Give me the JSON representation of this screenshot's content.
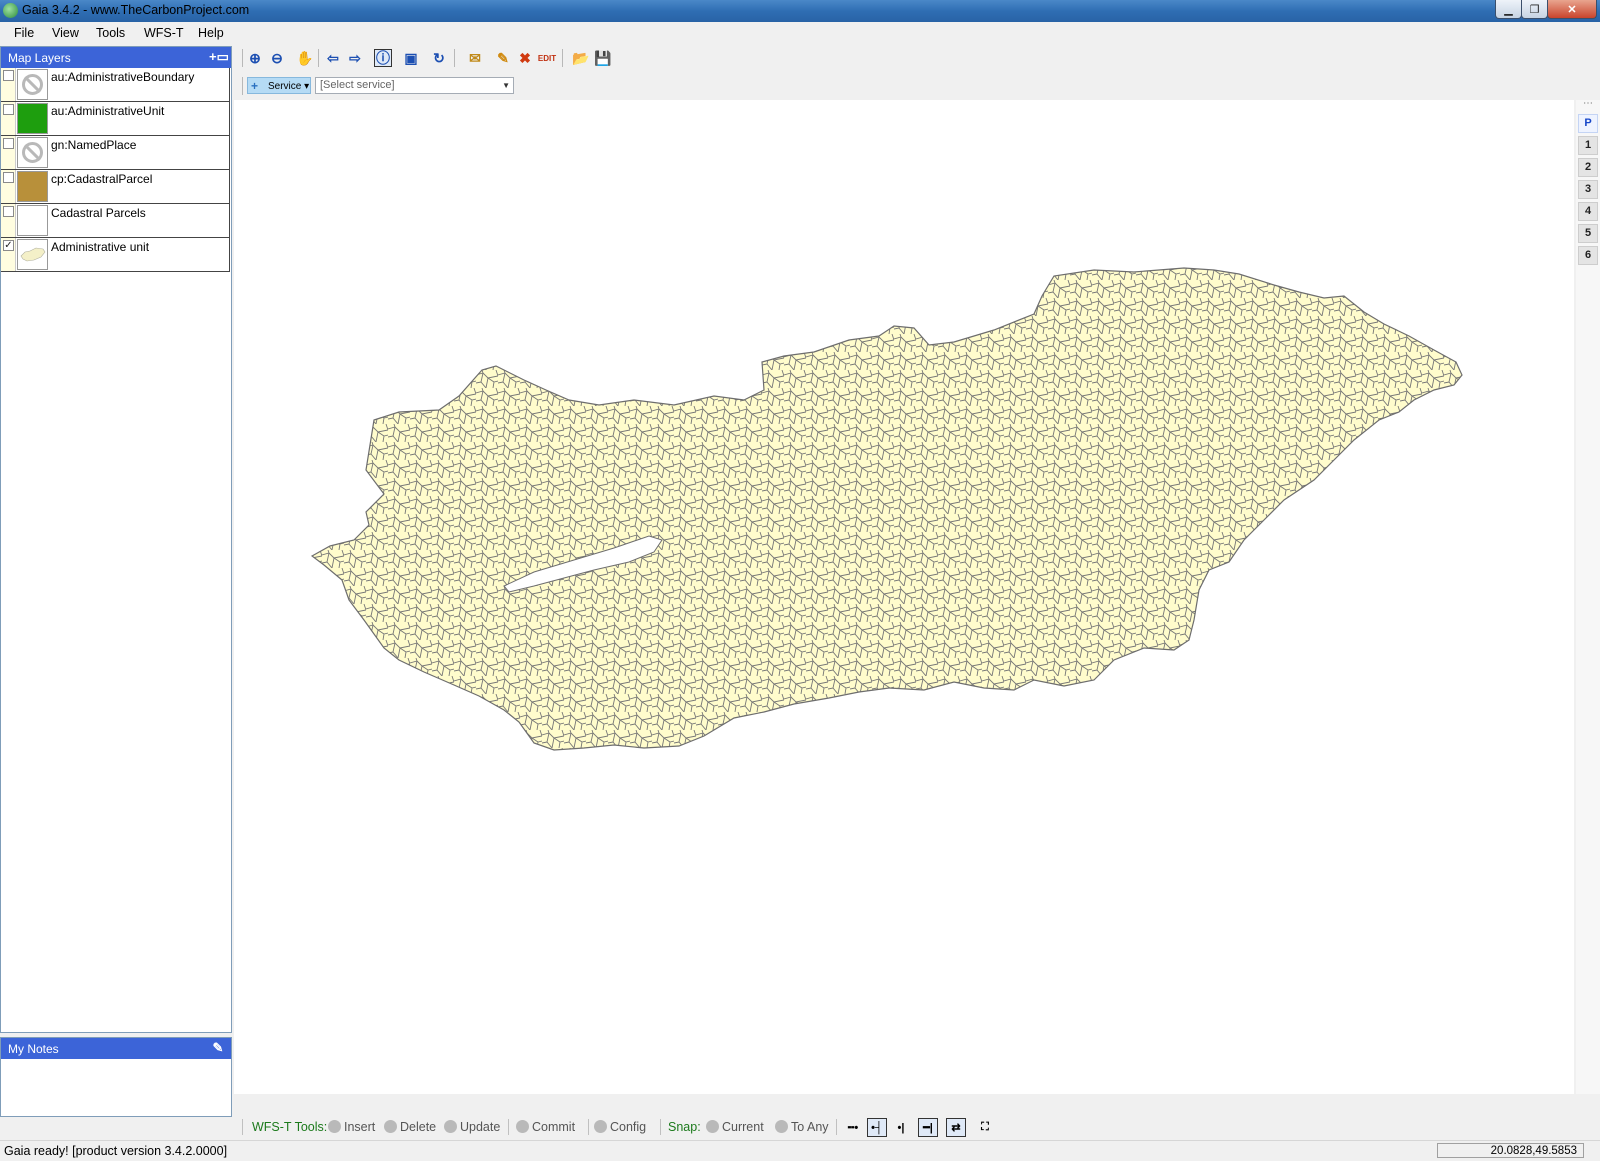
{
  "window": {
    "title": "Gaia 3.4.2 - www.TheCarbonProject.com"
  },
  "menu": [
    "File",
    "View",
    "Tools",
    "WFS-T",
    "Help"
  ],
  "layers_panel": {
    "title": "Map Layers",
    "layers": [
      {
        "name": "au:AdministrativeBoundary",
        "checked": false,
        "symbol": "no-symbol-icon"
      },
      {
        "name": "au:AdministrativeUnit",
        "checked": false,
        "symbol": "green-fill",
        "color": "#1e9e0e"
      },
      {
        "name": "gn:NamedPlace",
        "checked": false,
        "symbol": "no-symbol-icon"
      },
      {
        "name": "cp:CadastralParcel",
        "checked": false,
        "symbol": "brown-fill",
        "color": "#b8903a"
      },
      {
        "name": "Cadastral Parcels",
        "checked": false,
        "symbol": "empty"
      },
      {
        "name": "Administrative unit",
        "checked": true,
        "symbol": "map-thumbnail"
      }
    ]
  },
  "notes_panel": {
    "title": "My Notes"
  },
  "service_bar": {
    "button": "Service",
    "select_placeholder": "[Select service]"
  },
  "page_tabs": [
    "P",
    "1",
    "2",
    "3",
    "4",
    "5",
    "6"
  ],
  "wfs_bar": {
    "label": "WFS-T Tools:",
    "tools": [
      "Insert",
      "Delete",
      "Update",
      "Commit",
      "Config"
    ],
    "snap_label": "Snap:",
    "snap_tools": [
      "Current",
      "To Any"
    ]
  },
  "status": {
    "message": "Gaia ready! [product version 3.4.2.0000]",
    "coordinates": "20.0828,49.5853"
  },
  "map": {
    "fill_color": "#fffccc",
    "line_color": "#6d6d6d"
  }
}
